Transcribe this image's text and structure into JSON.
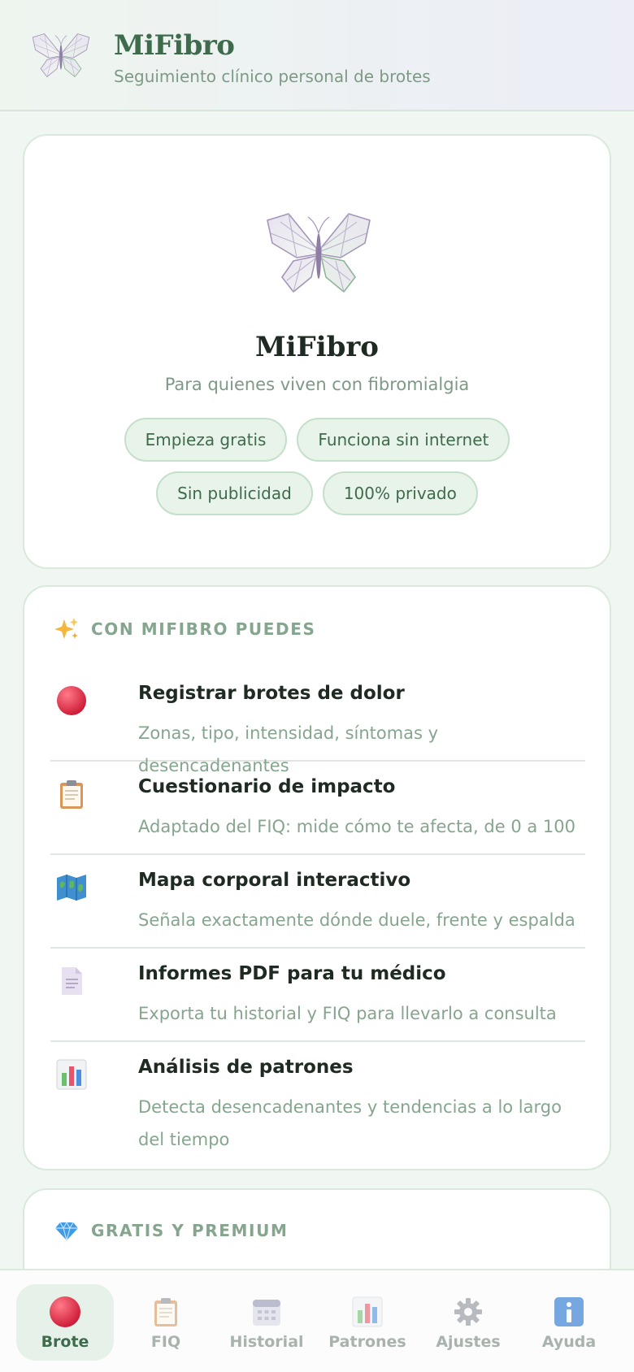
{
  "header": {
    "title": "MiFibro",
    "subtitle": "Seguimiento clínico personal de brotes",
    "logo_icon": "butterfly-icon"
  },
  "hero": {
    "title": "MiFibro",
    "subtitle": "Para quienes viven con fibromialgia",
    "chips": [
      "Empieza gratis",
      "Funciona sin internet",
      "Sin publicidad",
      "100% privado"
    ]
  },
  "features": {
    "icon": "sparkles-icon",
    "heading": "CON MIFIBRO PUEDES",
    "items": [
      {
        "icon": "red-circle-icon",
        "title": "Registrar brotes de dolor",
        "desc": "Zonas, tipo, intensidad, síntomas y desencadenantes"
      },
      {
        "icon": "clipboard-icon",
        "title": "Cuestionario de impacto",
        "desc": "Adaptado del FIQ: mide cómo te afecta, de 0 a 100"
      },
      {
        "icon": "map-icon",
        "title": "Mapa corporal interactivo",
        "desc": "Señala exactamente dónde duele, frente y espalda"
      },
      {
        "icon": "document-icon",
        "title": "Informes PDF para tu médico",
        "desc": "Exporta tu historial y FIQ para llevarlo a consulta"
      },
      {
        "icon": "bar-chart-icon",
        "title": "Análisis de patrones",
        "desc": "Detecta desencadenantes y tendencias a lo largo del tiempo"
      }
    ]
  },
  "premium": {
    "icon": "gem-icon",
    "heading": "GRATIS Y PREMIUM"
  },
  "nav": {
    "active": "Brote",
    "items": [
      {
        "label": "Brote",
        "icon": "red-circle-icon"
      },
      {
        "label": "FIQ",
        "icon": "clipboard-icon"
      },
      {
        "label": "Historial",
        "icon": "calendar-icon"
      },
      {
        "label": "Patrones",
        "icon": "bar-chart-icon"
      },
      {
        "label": "Ajustes",
        "icon": "gear-icon"
      },
      {
        "label": "Ayuda",
        "icon": "info-icon"
      }
    ]
  },
  "colors": {
    "brand": "#3e6b4c",
    "muted": "#86a58e",
    "background": "#f0f6f1",
    "chip_bg": "#e8f3ea"
  }
}
